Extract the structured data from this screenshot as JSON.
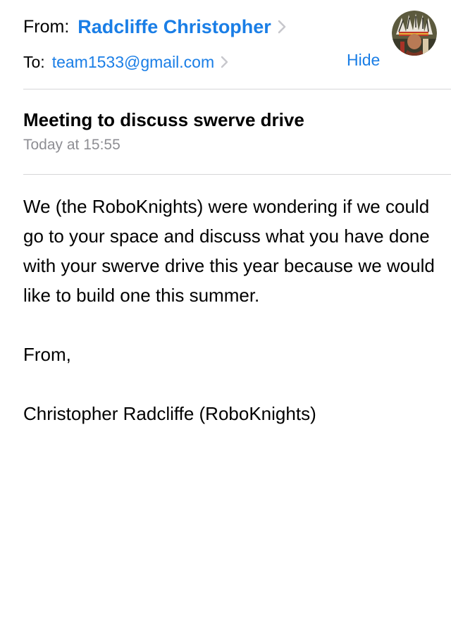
{
  "header": {
    "from_label": "From:",
    "sender_name": "Radcliffe Christopher",
    "to_label": "To:",
    "recipient": "team1533@gmail.com",
    "hide_label": "Hide"
  },
  "message": {
    "subject": "Meeting to discuss swerve drive",
    "timestamp": "Today at 15:55",
    "paragraphs": [
      "We (the RoboKnights) were wondering if we could go to your space and discuss what you have done with your swerve drive this year because we would like to build one this summer.",
      "From,",
      "Christopher Radcliffe (RoboKnights)"
    ]
  },
  "colors": {
    "link": "#1a7ee6",
    "secondary_text": "#8e8e93",
    "divider": "#d6d6d8"
  },
  "icons": {
    "sender_chevron": "chevron-right-icon",
    "recipient_chevron": "chevron-right-icon",
    "avatar": "contact-avatar"
  }
}
